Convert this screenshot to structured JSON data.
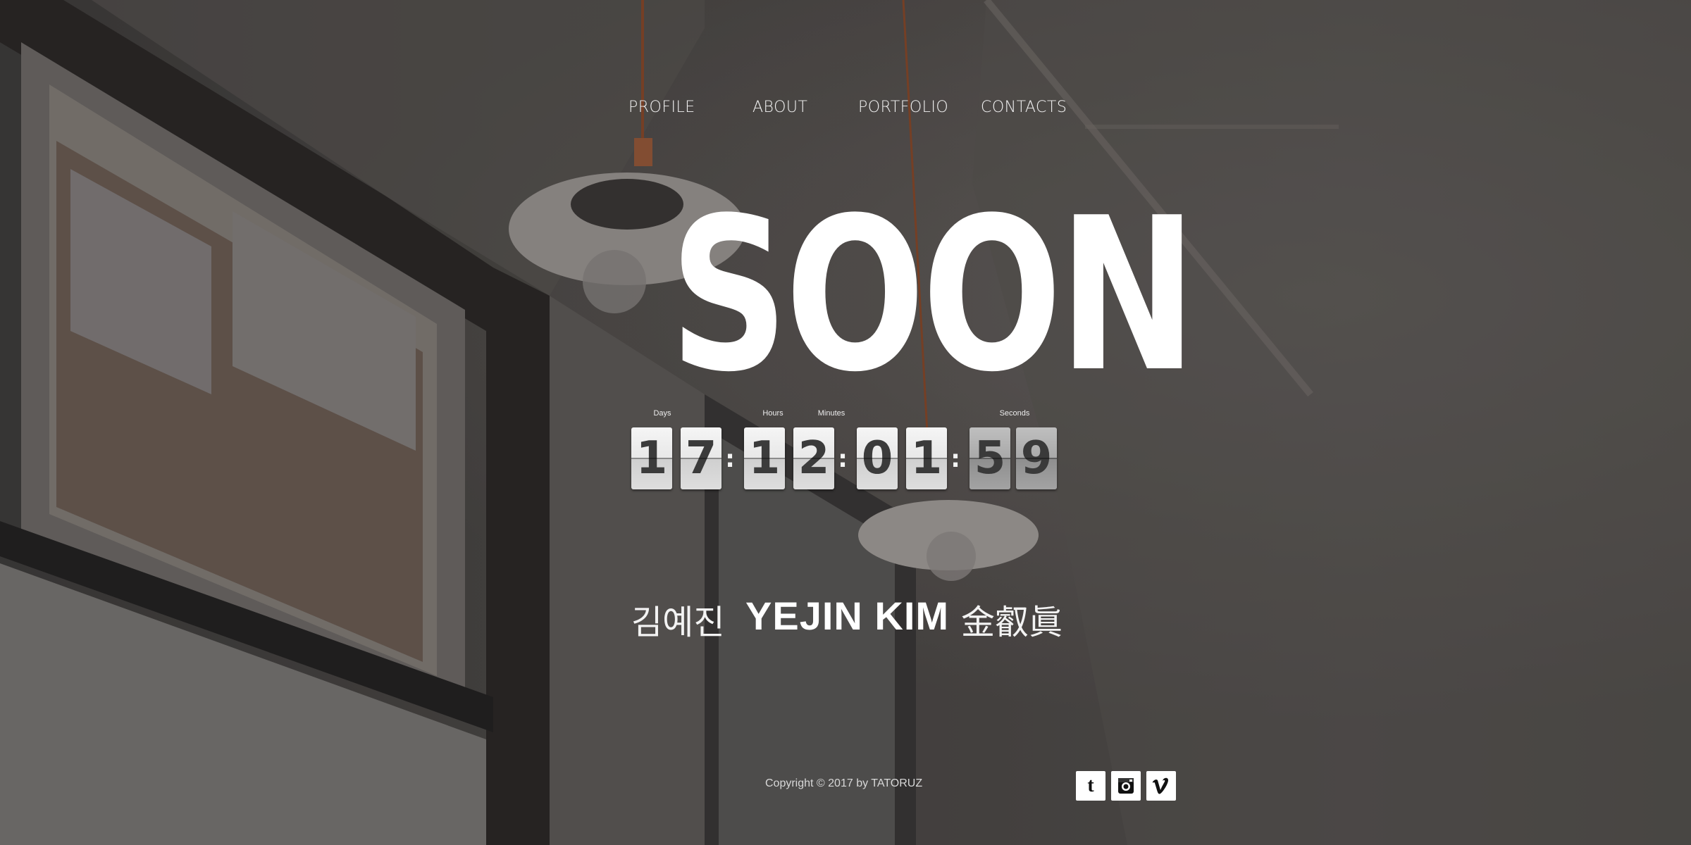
{
  "nav": {
    "items": [
      {
        "label": "PROFILE"
      },
      {
        "label": "ABOUT"
      },
      {
        "label": "PORTFOLIO"
      },
      {
        "label": "CONTACTS"
      }
    ]
  },
  "headline": "SOON",
  "countdown": {
    "labels": {
      "days": "Days",
      "hours": "Hours",
      "minutes": "Minutes",
      "seconds": "Seconds"
    },
    "digits": {
      "days": [
        "1",
        "7"
      ],
      "hours": [
        "1",
        "2"
      ],
      "minutes": [
        "0",
        "1"
      ],
      "seconds": [
        "5",
        "9"
      ]
    },
    "separator": ":"
  },
  "name": {
    "korean": "김예진",
    "english": "YEJIN KIM",
    "hanja": "金叡眞"
  },
  "footer": {
    "copyright": "Copyright © 2017 by TATORUZ",
    "social": [
      {
        "icon": "tumblr-icon"
      },
      {
        "icon": "instagram-icon"
      },
      {
        "icon": "vimeo-icon"
      }
    ]
  },
  "colors": {
    "text": "#ffffff",
    "flip_card": "#e8e8e8",
    "flip_digit": "#3b3b3b",
    "social_bg": "#ffffff"
  }
}
